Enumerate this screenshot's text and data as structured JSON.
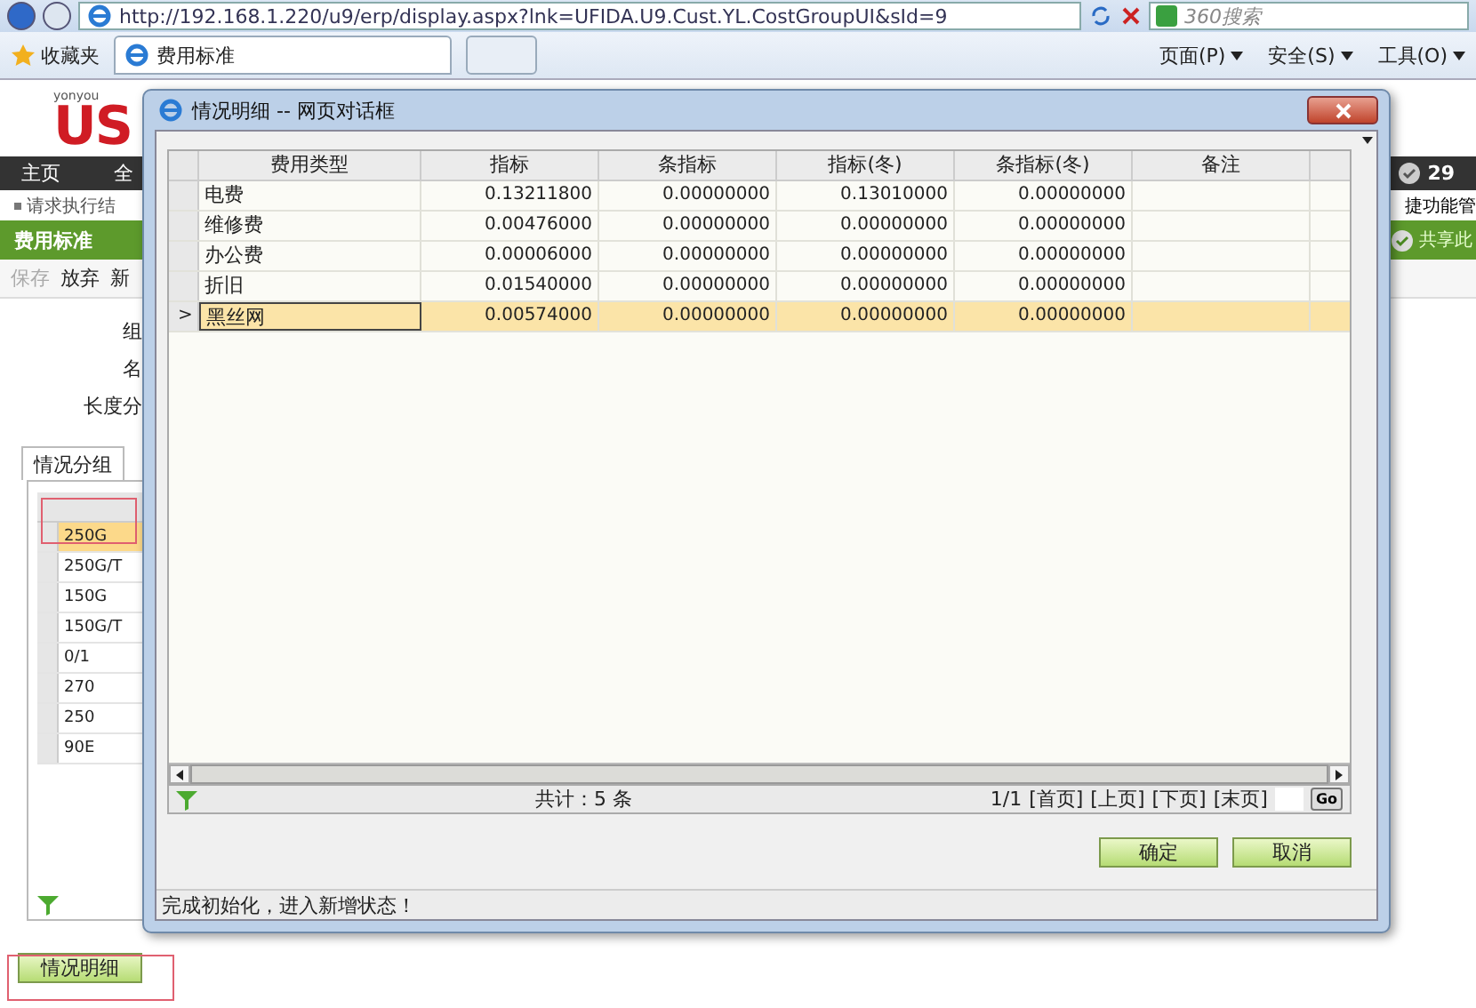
{
  "browser": {
    "url": "http://192.168.1.220/u9/erp/display.aspx?lnk=UFIDA.U9.Cust.YL.CostGroupUI&sId=9",
    "search_placeholder": "360搜索",
    "favorites": "收藏夹",
    "tab": "费用标准",
    "menus": [
      "页面(P)",
      "安全(S)",
      "工具(O)"
    ]
  },
  "app": {
    "logo_tag": "yonyou",
    "logo": "US",
    "nav": [
      "主页",
      "全"
    ],
    "badge": "29",
    "message": "请求执行结",
    "quick": "捷功能管",
    "page_title": "费用标准",
    "share": "共享此",
    "toolbar": [
      {
        "label": "保存",
        "disabled": true
      },
      {
        "label": "放弃",
        "disabled": false
      },
      {
        "label": "新",
        "disabled": false
      }
    ],
    "fields": [
      "组",
      "名",
      "长度分"
    ],
    "tab": "情况分组",
    "groups": [
      {
        "label": "250G",
        "selected": true
      },
      {
        "label": "250G/T",
        "selected": false
      },
      {
        "label": "150G",
        "selected": false
      },
      {
        "label": "150G/T",
        "selected": false
      },
      {
        "label": "0/1",
        "selected": false
      },
      {
        "label": "270",
        "selected": false
      },
      {
        "label": "250",
        "selected": false
      },
      {
        "label": "90E",
        "selected": false
      }
    ],
    "detail_button": "情况明细"
  },
  "dialog": {
    "title": "情况明细 -- 网页对话框",
    "columns": [
      "费用类型",
      "指标",
      "条指标",
      "指标(冬)",
      "条指标(冬)",
      "备注"
    ],
    "rows": [
      {
        "cells": [
          "电费",
          "0.13211800",
          "0.00000000",
          "0.13010000",
          "0.00000000",
          ""
        ],
        "selected": false,
        "marker": ""
      },
      {
        "cells": [
          "维修费",
          "0.00476000",
          "0.00000000",
          "0.00000000",
          "0.00000000",
          ""
        ],
        "selected": false,
        "marker": ""
      },
      {
        "cells": [
          "办公费",
          "0.00006000",
          "0.00000000",
          "0.00000000",
          "0.00000000",
          ""
        ],
        "selected": false,
        "marker": ""
      },
      {
        "cells": [
          "折旧",
          "0.01540000",
          "0.00000000",
          "0.00000000",
          "0.00000000",
          ""
        ],
        "selected": false,
        "marker": ""
      },
      {
        "cells": [
          "黑丝网",
          "0.00574000",
          "0.00000000",
          "0.00000000",
          "0.00000000",
          ""
        ],
        "selected": true,
        "marker": ">"
      }
    ],
    "total": "共计：5 条",
    "pager": {
      "info": "1/1",
      "links": [
        "[首页]",
        "[上页]",
        "[下页]",
        "[末页]"
      ],
      "go": "Go"
    },
    "buttons": [
      "确定",
      "取消"
    ],
    "status": "完成初始化，进入新增状态！"
  }
}
